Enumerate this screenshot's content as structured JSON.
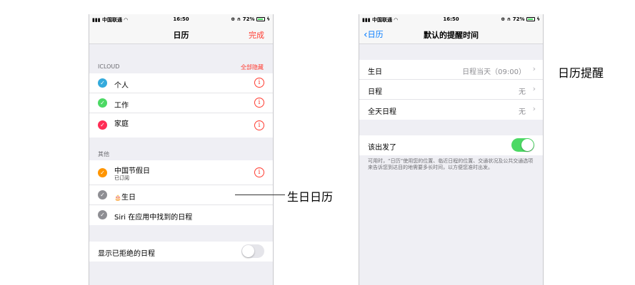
{
  "status": {
    "carrier": "中国联通",
    "time": "16:50",
    "battery": "72%"
  },
  "left": {
    "nav": {
      "title": "日历",
      "done": "完成"
    },
    "icloud": {
      "header": "ICLOUD",
      "hide_all": "全部隐藏",
      "items": [
        {
          "label": "个人",
          "color": "#34aadc"
        },
        {
          "label": "工作",
          "color": "#4cd964"
        },
        {
          "label": "家庭",
          "color": "#ff2d55"
        }
      ]
    },
    "other": {
      "header": "其他",
      "holiday": {
        "label": "中国节假日",
        "sub": "已订阅",
        "color": "#ff9500"
      },
      "birthday": {
        "mark": "🎂",
        "label": "生日",
        "color": "#8e8e93"
      },
      "siri": {
        "label": "Siri 在应用中找到的日程",
        "color": "#8e8e93"
      }
    },
    "declined": {
      "label": "显示已拒绝的日程",
      "on": false
    }
  },
  "right": {
    "nav": {
      "back": "日历",
      "title": "默认的提醒时间"
    },
    "rows": [
      {
        "label": "生日",
        "value": "日程当天（09:00）"
      },
      {
        "label": "日程",
        "value": "无"
      },
      {
        "label": "全天日程",
        "value": "无"
      }
    ],
    "leave": {
      "label": "该出发了",
      "on": true,
      "footnote": "可用时，“日历”使用您的位置、临近日程的位置、交通状况及公共交通选项来告诉您到达目的地需要多长时间，以方便您准时出发。"
    }
  },
  "annotations": {
    "birthday_calendar": "生日日历",
    "calendar_reminder": "日历提醒"
  },
  "icons": {
    "check": "✓",
    "info": "i",
    "chevron_right": "›",
    "chevron_left": "‹"
  }
}
